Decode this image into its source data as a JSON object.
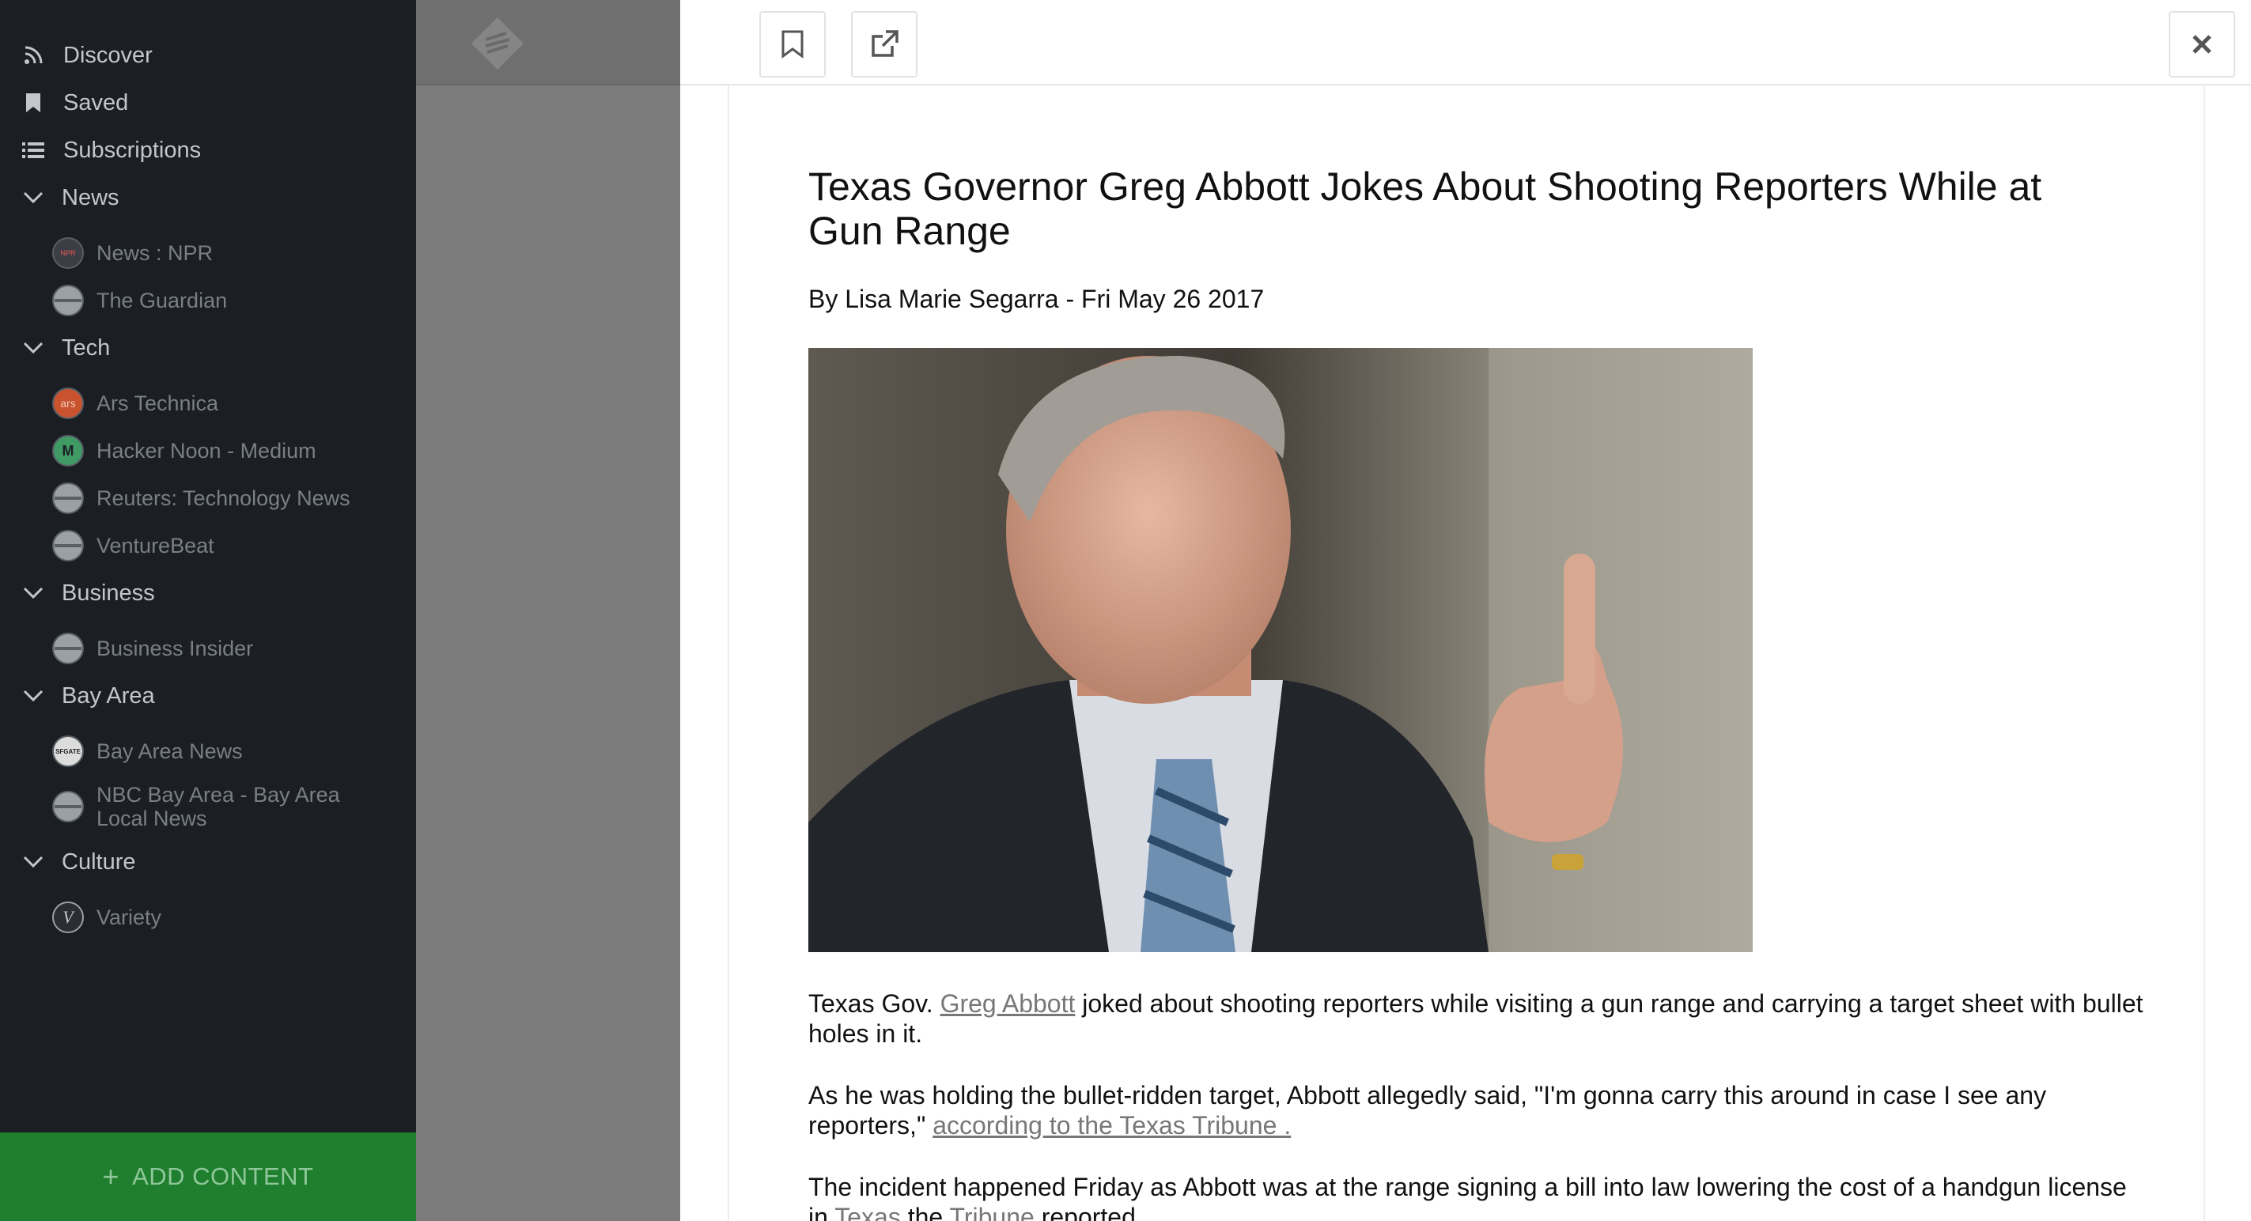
{
  "sidebar": {
    "nav": [
      {
        "label": "Discover",
        "icon": "rss-icon"
      },
      {
        "label": "Saved",
        "icon": "bookmark-icon"
      },
      {
        "label": "Subscriptions",
        "icon": "list-icon"
      }
    ],
    "categories": [
      {
        "label": "News",
        "feeds": [
          {
            "label": "News : NPR",
            "badge": "NPR"
          },
          {
            "label": "The Guardian"
          }
        ]
      },
      {
        "label": "Tech",
        "feeds": [
          {
            "label": "Ars Technica",
            "badge": "ars"
          },
          {
            "label": "Hacker Noon - Medium",
            "badge": "M"
          },
          {
            "label": "Reuters: Technology News"
          },
          {
            "label": "VentureBeat"
          }
        ]
      },
      {
        "label": "Business",
        "feeds": [
          {
            "label": "Business Insider"
          }
        ]
      },
      {
        "label": "Bay Area",
        "feeds": [
          {
            "label": "Bay Area News",
            "badge": "SFGATE"
          },
          {
            "label": "NBC Bay Area - Bay Area Local News"
          }
        ]
      },
      {
        "label": "Culture",
        "feeds": [
          {
            "label": "Variety",
            "badge": "V"
          }
        ]
      }
    ],
    "add_content": "ADD CONTENT"
  },
  "reader": {
    "toolbar": {
      "bookmark_icon": "bookmark-icon",
      "open_icon": "external-link-icon",
      "close_icon": "close-icon"
    },
    "article": {
      "title": "Texas Governor Greg Abbott Jokes About Shooting Reporters While at Gun Range",
      "byline": "By Lisa Marie Segarra - Fri May 26 2017",
      "p1": {
        "before": "Texas Gov. ",
        "link": "Greg Abbott",
        "after": " joked about shooting reporters while visiting a gun range and carrying a target sheet with bullet holes in it."
      },
      "p2": {
        "before": "As he was holding the bullet-ridden target, Abbott allegedly said, \"I'm gonna carry this around in case I see any reporters,\" ",
        "link1": "according to the Texas ",
        "link2": "Tribune ",
        "link3": "."
      },
      "p3": {
        "text": "The incident happened Friday as Abbott was at the range signing a bill into law lowering the cost of a handgun license",
        "line2_before": "in ",
        "line2_link": "Texas",
        "line2_mid": " the ",
        "line2_link2": "Tribune",
        "line2_after": " reported"
      }
    }
  },
  "colors": {
    "sidebar_bg": "#1b1f24",
    "add_content_bg": "#1f7f2e",
    "overlay": "#7b7b7b"
  }
}
